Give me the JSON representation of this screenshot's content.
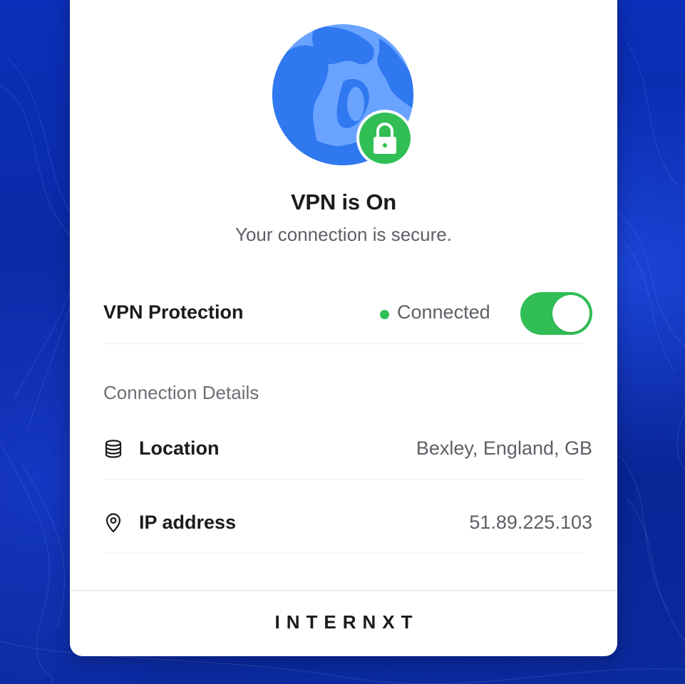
{
  "status": {
    "title": "VPN is On",
    "subtitle": "Your connection is secure."
  },
  "protection": {
    "label": "VPN Protection",
    "state_text": "Connected",
    "toggle_on": true,
    "status_color": "#2fbf57"
  },
  "details": {
    "heading": "Connection Details",
    "location": {
      "icon": "database-icon",
      "label": "Location",
      "value": "Bexley, England, GB"
    },
    "ip": {
      "icon": "map-pin-icon",
      "label": "IP address",
      "value": "51.89.225.103"
    }
  },
  "footer": {
    "brand": "INTERNXT"
  },
  "colors": {
    "accent_green": "#31bf55",
    "globe_blue": "#3b82f6",
    "globe_light": "#6aa3ff",
    "background_blue": "#0b2fb8"
  }
}
